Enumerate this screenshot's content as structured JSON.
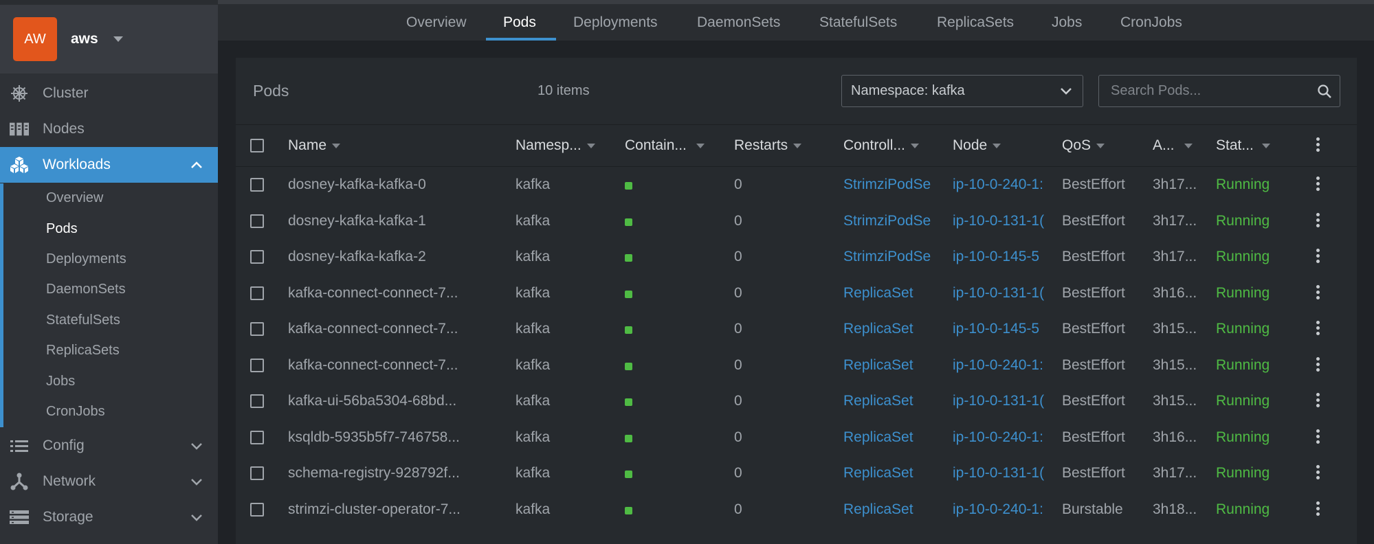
{
  "sidebar": {
    "avatar": "AW",
    "cluster_name": "aws",
    "items": [
      {
        "label": "Cluster",
        "icon": "helm-wheel-icon"
      },
      {
        "label": "Nodes",
        "icon": "server-rack-icon"
      },
      {
        "label": "Workloads",
        "icon": "cubes-icon"
      },
      {
        "label": "Config",
        "icon": "list-icon"
      },
      {
        "label": "Network",
        "icon": "network-icon"
      },
      {
        "label": "Storage",
        "icon": "storage-icon"
      }
    ],
    "workload_sub": [
      "Overview",
      "Pods",
      "Deployments",
      "DaemonSets",
      "StatefulSets",
      "ReplicaSets",
      "Jobs",
      "CronJobs"
    ],
    "accent": "#3d90ce"
  },
  "tabs": [
    "Overview",
    "Pods",
    "Deployments",
    "DaemonSets",
    "StatefulSets",
    "ReplicaSets",
    "Jobs",
    "CronJobs"
  ],
  "panel": {
    "title": "Pods",
    "count": "10 items",
    "namespace": "Namespace: kafka",
    "search_placeholder": "Search Pods..."
  },
  "table": {
    "headers": [
      "Name",
      "Namesp...",
      "Contain...",
      "Restarts",
      "Controll...",
      "Node",
      "QoS",
      "A...",
      "Stat..."
    ],
    "rows": [
      {
        "name": "dosney-kafka-kafka-0",
        "ns": "kafka",
        "restarts": "0",
        "controller": "StrimziPodSe",
        "node": "ip-10-0-240-1:",
        "qos": "BestEffort",
        "age": "3h17...",
        "status": "Running"
      },
      {
        "name": "dosney-kafka-kafka-1",
        "ns": "kafka",
        "restarts": "0",
        "controller": "StrimziPodSe",
        "node": "ip-10-0-131-1(",
        "qos": "BestEffort",
        "age": "3h17...",
        "status": "Running"
      },
      {
        "name": "dosney-kafka-kafka-2",
        "ns": "kafka",
        "restarts": "0",
        "controller": "StrimziPodSe",
        "node": "ip-10-0-145-5",
        "qos": "BestEffort",
        "age": "3h17...",
        "status": "Running"
      },
      {
        "name": "kafka-connect-connect-7...",
        "ns": "kafka",
        "restarts": "0",
        "controller": "ReplicaSet",
        "node": "ip-10-0-131-1(",
        "qos": "BestEffort",
        "age": "3h16...",
        "status": "Running"
      },
      {
        "name": "kafka-connect-connect-7...",
        "ns": "kafka",
        "restarts": "0",
        "controller": "ReplicaSet",
        "node": "ip-10-0-145-5",
        "qos": "BestEffort",
        "age": "3h15...",
        "status": "Running"
      },
      {
        "name": "kafka-connect-connect-7...",
        "ns": "kafka",
        "restarts": "0",
        "controller": "ReplicaSet",
        "node": "ip-10-0-240-1:",
        "qos": "BestEffort",
        "age": "3h15...",
        "status": "Running"
      },
      {
        "name": "kafka-ui-56ba5304-68bd...",
        "ns": "kafka",
        "restarts": "0",
        "controller": "ReplicaSet",
        "node": "ip-10-0-131-1(",
        "qos": "BestEffort",
        "age": "3h15...",
        "status": "Running"
      },
      {
        "name": "ksqldb-5935b5f7-746758...",
        "ns": "kafka",
        "restarts": "0",
        "controller": "ReplicaSet",
        "node": "ip-10-0-240-1:",
        "qos": "BestEffort",
        "age": "3h16...",
        "status": "Running"
      },
      {
        "name": "schema-registry-928792f...",
        "ns": "kafka",
        "restarts": "0",
        "controller": "ReplicaSet",
        "node": "ip-10-0-131-1(",
        "qos": "BestEffort",
        "age": "3h17...",
        "status": "Running"
      },
      {
        "name": "strimzi-cluster-operator-7...",
        "ns": "kafka",
        "restarts": "0",
        "controller": "ReplicaSet",
        "node": "ip-10-0-240-1:",
        "qos": "Burstable",
        "age": "3h18...",
        "status": "Running"
      }
    ]
  }
}
